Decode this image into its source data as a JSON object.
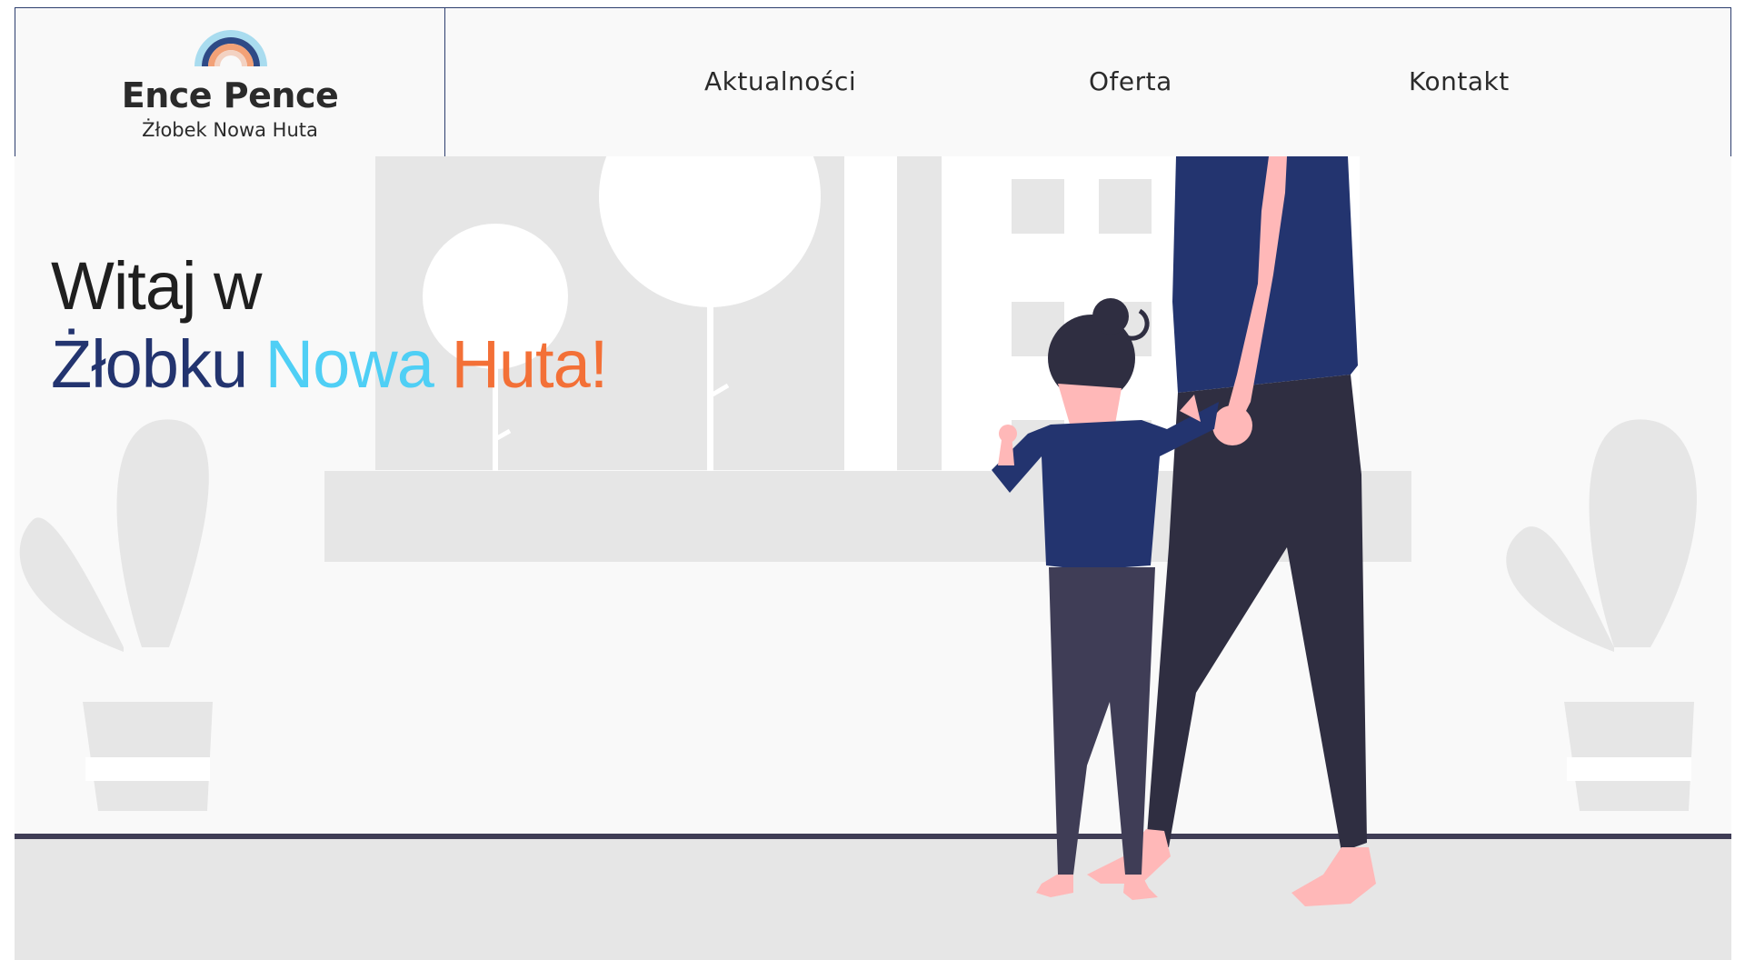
{
  "brand": {
    "title": "Ence Pence",
    "subtitle": "Żłobek Nowa Huta",
    "logo_icon": "rainbow-icon"
  },
  "nav": {
    "items": [
      {
        "label": "Aktualności"
      },
      {
        "label": "Oferta"
      },
      {
        "label": "Kontakt"
      }
    ]
  },
  "hero": {
    "line1": "Witaj w",
    "line2_part1": "Żłobku",
    "line2_part2": "Nowa",
    "line2_part3": "Huta!",
    "illustration": "mother-and-child-illustration"
  },
  "colors": {
    "navy": "#23346f",
    "light_blue": "#4fcff5",
    "orange": "#f37037",
    "border": "#2d3e6e"
  }
}
